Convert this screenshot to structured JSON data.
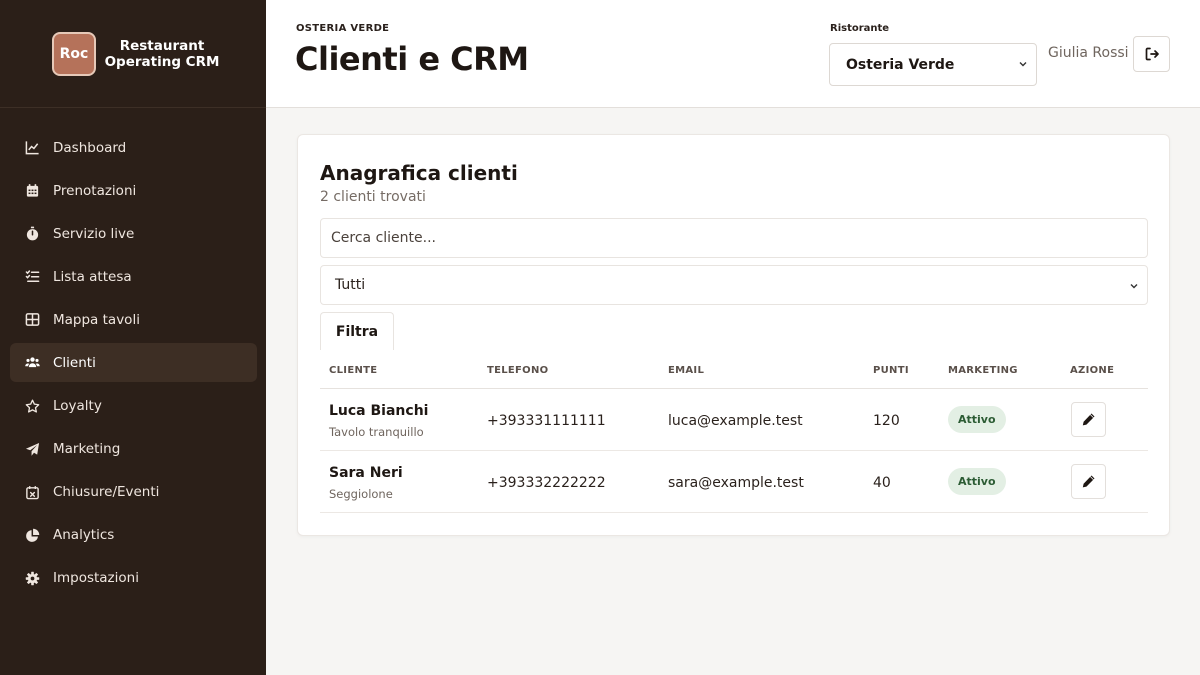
{
  "brand": {
    "logo_text": "Roc",
    "name": "Restaurant Operating CRM"
  },
  "sidebar": {
    "items": [
      {
        "label": "Dashboard",
        "icon": "chart-line-icon"
      },
      {
        "label": "Prenotazioni",
        "icon": "calendar-icon"
      },
      {
        "label": "Servizio live",
        "icon": "stopwatch-icon"
      },
      {
        "label": "Lista attesa",
        "icon": "list-check-icon"
      },
      {
        "label": "Mappa tavoli",
        "icon": "table-grid-icon"
      },
      {
        "label": "Clienti",
        "icon": "users-icon",
        "active": true
      },
      {
        "label": "Loyalty",
        "icon": "star-icon"
      },
      {
        "label": "Marketing",
        "icon": "paper-plane-icon"
      },
      {
        "label": "Chiusure/Eventi",
        "icon": "calendar-x-icon"
      },
      {
        "label": "Analytics",
        "icon": "pie-chart-icon"
      },
      {
        "label": "Impostazioni",
        "icon": "gear-icon"
      }
    ]
  },
  "header": {
    "eyebrow": "OSTERIA VERDE",
    "title": "Clienti e CRM",
    "restaurant_label": "Ristorante",
    "restaurant_selected": "Osteria Verde",
    "user_name": "Giulia Rossi"
  },
  "card": {
    "title": "Anagrafica clienti",
    "subtitle": "2 clienti trovati",
    "search_placeholder": "Cerca cliente...",
    "filter_selected": "Tutti",
    "filter_button": "Filtra"
  },
  "table": {
    "columns": [
      "CLIENTE",
      "TELEFONO",
      "EMAIL",
      "PUNTI",
      "MARKETING",
      "AZIONE"
    ],
    "rows": [
      {
        "name": "Luca Bianchi",
        "note": "Tavolo tranquillo",
        "phone": "+393331111111",
        "email": "luca@example.test",
        "points": "120",
        "marketing": "Attivo"
      },
      {
        "name": "Sara Neri",
        "note": "Seggiolone",
        "phone": "+393332222222",
        "email": "sara@example.test",
        "points": "40",
        "marketing": "Attivo"
      }
    ]
  },
  "colors": {
    "sidebar_bg": "#2b1f18",
    "sidebar_active": "#3d2e24",
    "brand_logo": "#b5725a",
    "badge_bg": "#e3efe4",
    "badge_text": "#2c5c34"
  }
}
